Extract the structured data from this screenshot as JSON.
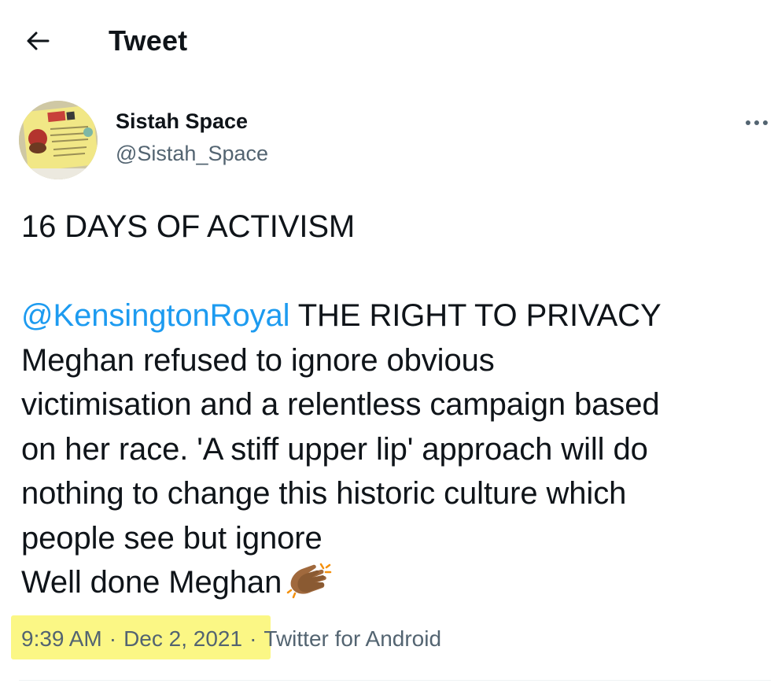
{
  "header": {
    "back_icon": "arrow-left-icon",
    "title": "Tweet"
  },
  "author": {
    "avatar_icon": "profile-avatar",
    "name": "Sistah Space",
    "handle": "@Sistah_Space",
    "more_icon": "more-horizontal-icon"
  },
  "tweet": {
    "line1": "16 DAYS OF ACTIVISM",
    "mention": "@KensingtonRoyal",
    "line2_rest": " THE RIGHT TO PRIVACY",
    "line3": "Meghan refused to ignore obvious",
    "line4": "victimisation and a relentless campaign based",
    "line5": "on her race. 'A stiff upper lip' approach will do",
    "line6": "nothing to change this historic culture which",
    "line7": "people see but ignore",
    "line8": "Well done Meghan",
    "emoji": "clapping-hands-icon"
  },
  "meta": {
    "time": "9:39 AM",
    "sep1": "·",
    "date": "Dec 2, 2021",
    "sep2": "·",
    "source": "Twitter for Android",
    "highlight_color": "#fbf785"
  },
  "colors": {
    "text": "#0f1419",
    "secondary": "#536471",
    "accent": "#1d9bf0"
  }
}
